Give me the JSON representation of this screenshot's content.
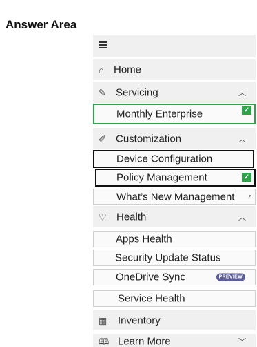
{
  "answer_area": {
    "title": "Answer Area"
  },
  "nav": {
    "menu_icon": "hamburger-icon",
    "home": {
      "label": "Home",
      "icon": "home-icon"
    },
    "servicing": {
      "label": "Servicing",
      "icon": "servicing-icon",
      "items": [
        {
          "label": "Monthly Enterprise",
          "checked": true
        }
      ]
    },
    "customization": {
      "label": "Customization",
      "icon": "customization-icon",
      "items": [
        {
          "label": "Device Configuration",
          "checked": false
        },
        {
          "label": "Policy Management",
          "checked": true
        },
        {
          "label": "What’s New Management",
          "external": true
        }
      ]
    },
    "health": {
      "label": "Health",
      "icon": "heart-icon",
      "items": [
        {
          "label": "Apps Health"
        },
        {
          "label": "Security Update Status"
        },
        {
          "label": "OneDrive Sync",
          "badge": "PREVIEW"
        },
        {
          "label": "Service Health"
        }
      ]
    },
    "inventory": {
      "label": "Inventory",
      "icon": "inventory-icon"
    },
    "learn_more": {
      "label": "Learn More",
      "icon": "book-icon"
    }
  },
  "colors": {
    "check_green": "#2fa34a",
    "selected_border": "#2fa34a",
    "badge_bg": "#5c5c96",
    "highlight_border": "#111111"
  }
}
